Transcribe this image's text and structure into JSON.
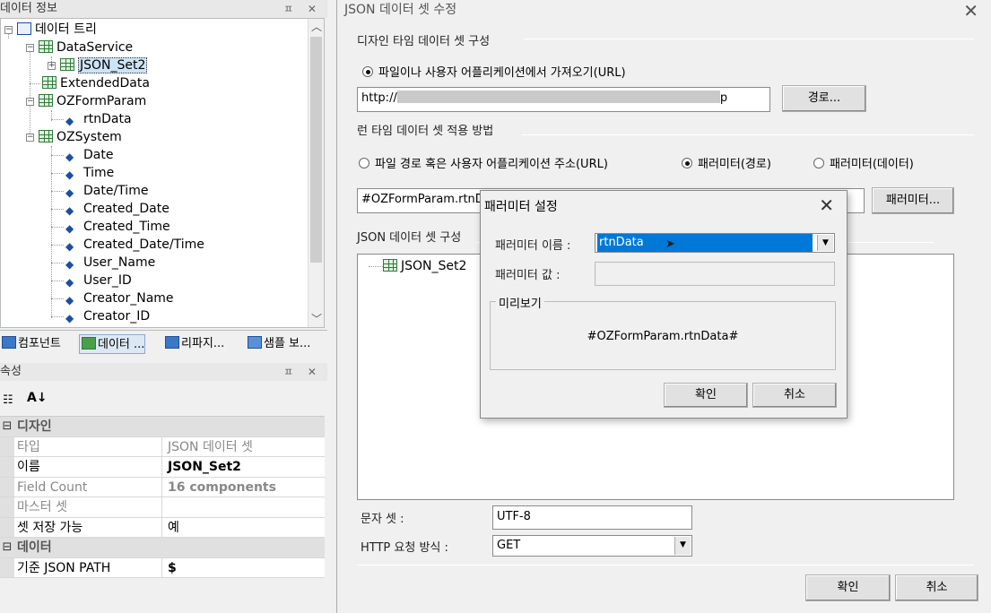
{
  "left": {
    "tree_panel_title": "데이터 정보",
    "tree_panel_controls": "ㅍ ✕",
    "tree": {
      "root": "데이터 트리",
      "data_service": "DataService",
      "json_set": "JSON_Set2",
      "extended_data": "ExtendedData",
      "ozformparam": "OZFormParam",
      "rtndata": "rtnData",
      "ozsystem": "OZSystem",
      "fields": [
        "Date",
        "Time",
        "Date/Time",
        "Created_Date",
        "Created_Time",
        "Created_Date/Time",
        "User_Name",
        "User_ID",
        "Creator_Name",
        "Creator_ID"
      ]
    },
    "bottom_tabs": [
      "컴포넌트",
      "데이터 ...",
      "리파지...",
      "샘플 보..."
    ],
    "props_panel_title": "속성",
    "props_panel_controls": "ㅍ ✕",
    "props": {
      "cat_design": "디자인",
      "type_k": "타입",
      "type_v": "JSON 데이터 셋",
      "name_k": "이름",
      "name_v": "JSON_Set2",
      "fieldcount_k": "Field Count",
      "fieldcount_v": "16 components",
      "master_k": "마스터 셋",
      "master_v": "",
      "savable_k": "셋 저장 가능",
      "savable_v": "예",
      "cat_data": "데이터",
      "jsonpath_k": "기준 JSON PATH",
      "jsonpath_v": "$",
      "collapse_glyph": "⊟"
    }
  },
  "dialog": {
    "title": "JSON 데이터 셋 수정",
    "design_group": "디자인 타임 데이터 셋 구성",
    "radio_url": "파일이나 사용자 어플리케이션에서 가져오기(URL)",
    "url_prefix": "http://",
    "url_suffix": "p",
    "path_button": "경로...",
    "runtime_group": "런 타임 데이터 셋 적용 방법",
    "rt_radio_url": "파일 경로 혹은 사용자 어플리케이션 주소(URL)",
    "rt_radio_param_path": "패러미터(경로)",
    "rt_radio_param_data": "패러미터(데이터)",
    "param_field_value": "#OZFormParam.rtnData#",
    "param_button": "패러미터...",
    "json_config_label": "JSON 데이터 셋 구성",
    "json_tree_item": "JSON_Set2",
    "charset_label": "문자 셋 :",
    "charset_value": "UTF-8",
    "http_method_label": "HTTP 요청 방식 :",
    "http_method_value": "GET",
    "ok": "확인",
    "cancel": "취소"
  },
  "param_dialog": {
    "title": "패러미터 설정",
    "name_label": "패러미터 이름 :",
    "name_value": "rtnData",
    "value_label": "패러미터 값 :",
    "value_value": "",
    "preview_label": "미리보기",
    "preview_text": "#OZFormParam.rtnData#",
    "ok": "확인",
    "cancel": "취소"
  }
}
